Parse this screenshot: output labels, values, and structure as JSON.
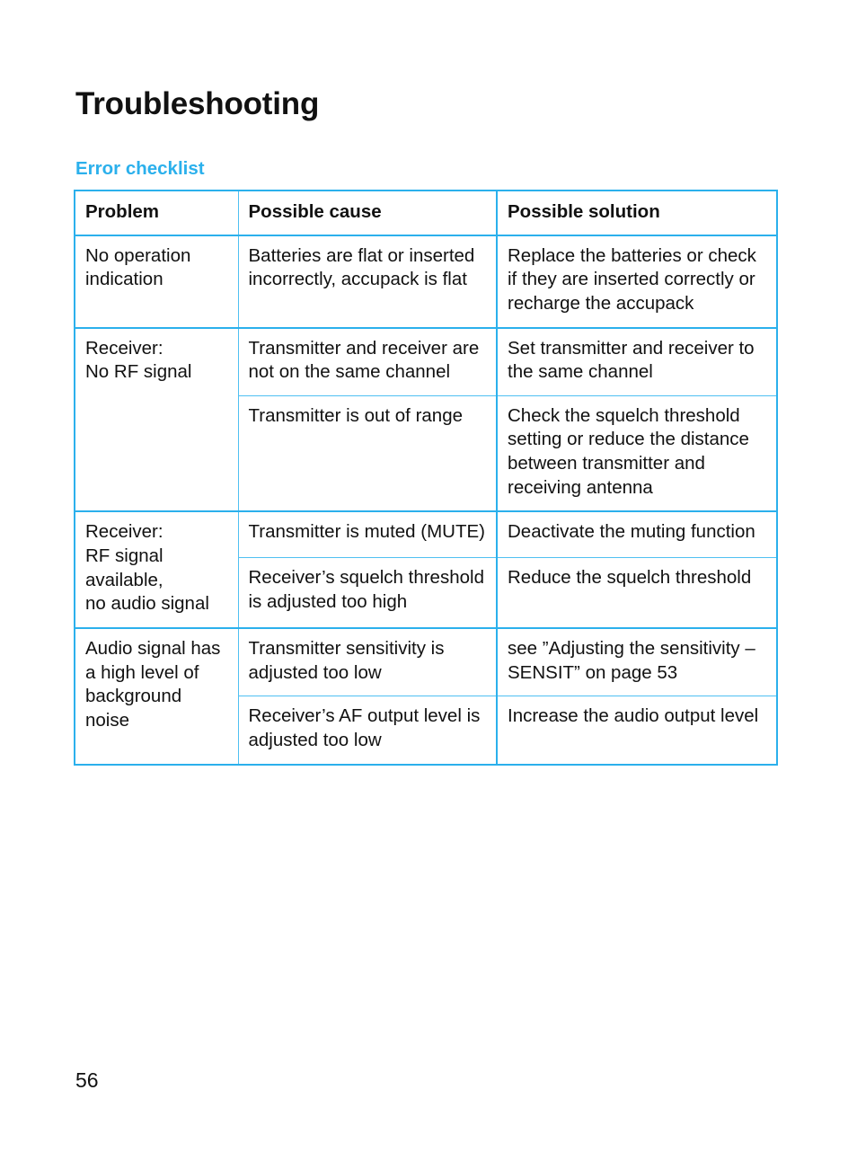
{
  "document": {
    "title": "Troubleshooting",
    "section_heading": "Error checklist",
    "page_number": "56",
    "accent_color": "#2BB0EC",
    "rule_color_thin": "#4FC0F2",
    "text_color": "#111111"
  },
  "table": {
    "headers": {
      "problem": "Problem",
      "cause": "Possible cause",
      "solution": "Possible solution"
    },
    "groups": [
      {
        "problem": "No operation indication",
        "rows": [
          {
            "cause": "Batteries are flat or inserted incorrectly, accupack is flat",
            "solution": "Replace the batteries or check if they are inserted correctly or recharge the accupack"
          }
        ]
      },
      {
        "problem": "Receiver:\nNo RF signal",
        "rows": [
          {
            "cause": "Transmitter and receiver are not on the same channel",
            "solution": "Set transmitter and receiver to the same channel"
          },
          {
            "cause": "Transmitter is out of range",
            "solution": "Check the squelch threshold setting or reduce the distance between transmitter and receiving antenna"
          }
        ]
      },
      {
        "problem": "Receiver:\nRF signal available,\nno audio signal",
        "rows": [
          {
            "cause": "Transmitter is muted (MUTE)",
            "solution": "Deactivate the muting function"
          },
          {
            "cause": "Receiver’s squelch threshold is adjusted too high",
            "solution": "Reduce the squelch threshold"
          }
        ]
      },
      {
        "problem": "Audio signal has a high level of background noise",
        "rows": [
          {
            "cause": "Transmitter sensitivity is adjusted too low",
            "solution": "see ”Adjusting the sensitivity – SENSIT” on page 53"
          },
          {
            "cause": "Receiver’s AF output level is adjusted too low",
            "solution": "Increase the audio output level"
          }
        ]
      }
    ]
  }
}
